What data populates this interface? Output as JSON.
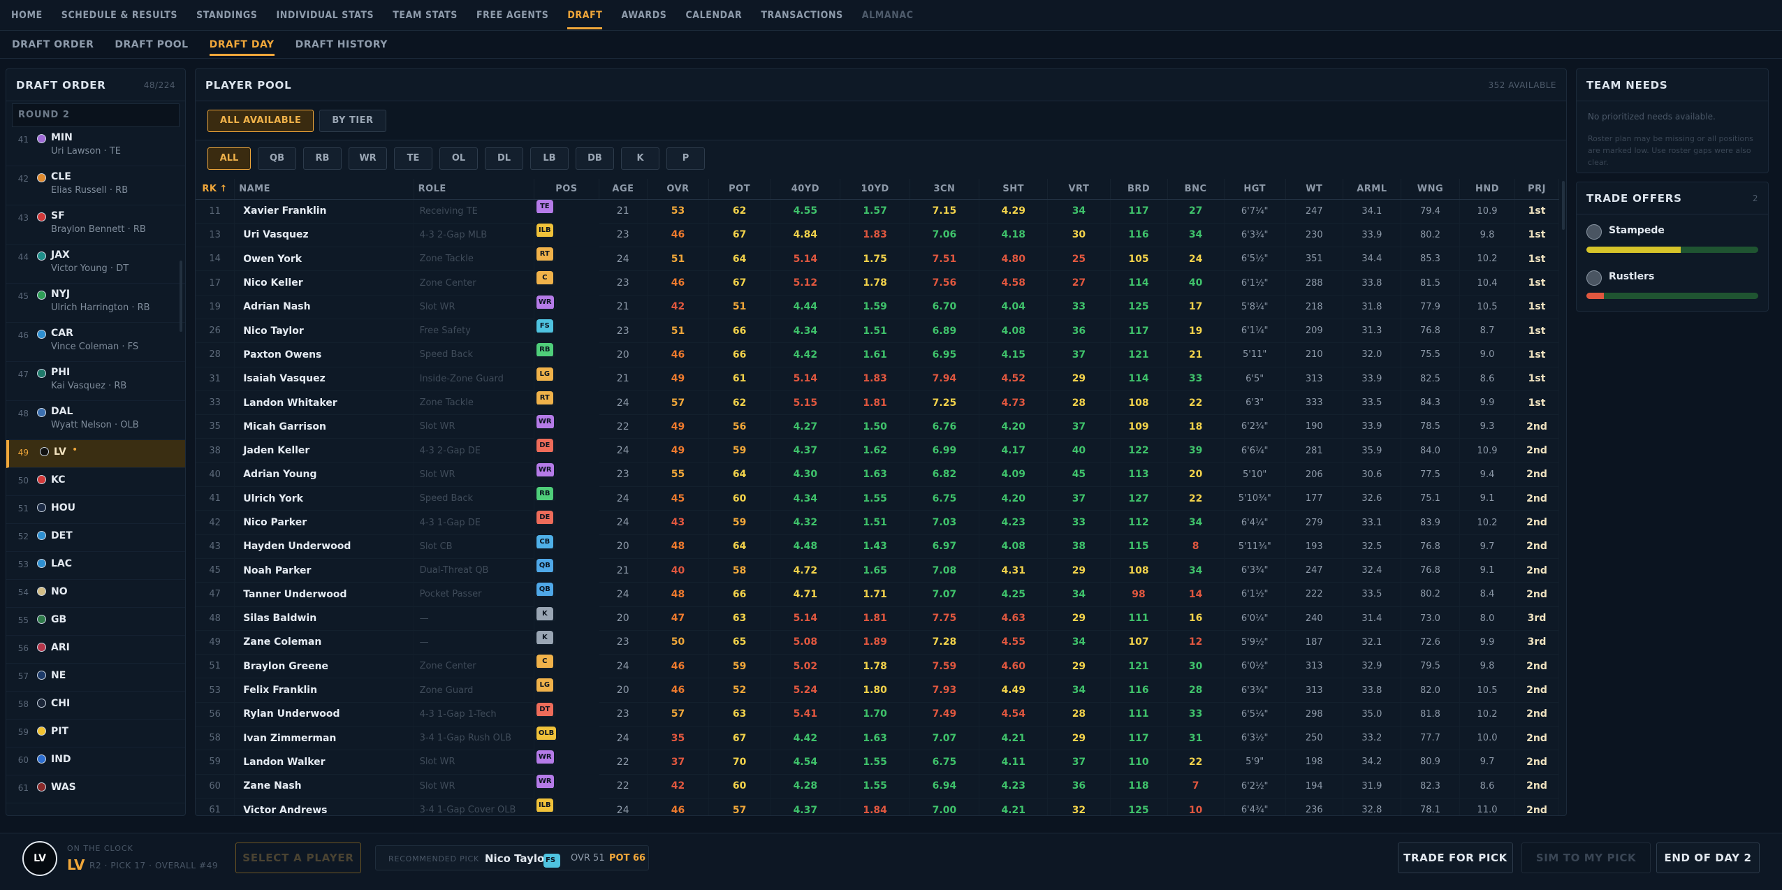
{
  "topnav": [
    "HOME",
    "SCHEDULE & RESULTS",
    "STANDINGS",
    "INDIVIDUAL STATS",
    "TEAM STATS",
    "FREE AGENTS",
    "DRAFT",
    "AWARDS",
    "CALENDAR",
    "TRANSACTIONS",
    "ALMANAC"
  ],
  "subnav": [
    "DRAFT ORDER",
    "DRAFT POOL",
    "DRAFT DAY",
    "DRAFT HISTORY"
  ],
  "draft_order": {
    "title": "DRAFT ORDER",
    "count": "48/224",
    "round": "ROUND 2",
    "picks": [
      {
        "n": "41",
        "team": "MIN",
        "player": "Uri Lawson · TE",
        "color": "#a06bd6"
      },
      {
        "n": "42",
        "team": "CLE",
        "player": "Elias Russell · RB",
        "color": "#e08a2e"
      },
      {
        "n": "43",
        "team": "SF",
        "player": "Braylon Bennett · RB",
        "color": "#d33a3a"
      },
      {
        "n": "44",
        "team": "JAX",
        "player": "Victor Young · DT",
        "color": "#1f8f8a"
      },
      {
        "n": "45",
        "team": "NYJ",
        "player": "Ulrich Harrington · RB",
        "color": "#2f9e57"
      },
      {
        "n": "46",
        "team": "CAR",
        "player": "Vince Coleman · FS",
        "color": "#2e8fd0"
      },
      {
        "n": "47",
        "team": "PHI",
        "player": "Kai Vasquez · RB",
        "color": "#1f7a6a"
      },
      {
        "n": "48",
        "team": "DAL",
        "player": "Wyatt Nelson · OLB",
        "color": "#3b6fb0"
      },
      {
        "n": "49",
        "team": "LV",
        "player": "",
        "color": "#111111",
        "current": true,
        "mark": "•"
      },
      {
        "n": "50",
        "team": "KC",
        "player": "",
        "color": "#d33a3a"
      },
      {
        "n": "51",
        "team": "HOU",
        "player": "",
        "color": "#1b2a44"
      },
      {
        "n": "52",
        "team": "DET",
        "player": "",
        "color": "#2e8fd0"
      },
      {
        "n": "53",
        "team": "LAC",
        "player": "",
        "color": "#2e8fd0"
      },
      {
        "n": "54",
        "team": "NO",
        "player": "",
        "color": "#d2bd86"
      },
      {
        "n": "55",
        "team": "GB",
        "player": "",
        "color": "#2f7a4a"
      },
      {
        "n": "56",
        "team": "ARI",
        "player": "",
        "color": "#b6364a"
      },
      {
        "n": "57",
        "team": "NE",
        "player": "",
        "color": "#1d3a68"
      },
      {
        "n": "58",
        "team": "CHI",
        "player": "",
        "color": "#1b2638"
      },
      {
        "n": "59",
        "team": "PIT",
        "player": "",
        "color": "#f2c230"
      },
      {
        "n": "60",
        "team": "IND",
        "player": "",
        "color": "#2e6fd0"
      },
      {
        "n": "61",
        "team": "WAS",
        "player": "",
        "color": "#8a2a2a"
      }
    ]
  },
  "player_pool": {
    "title": "PLAYER POOL",
    "count": "352 AVAILABLE",
    "tabs": [
      "ALL AVAILABLE",
      "BY TIER"
    ],
    "positions": [
      "ALL",
      "QB",
      "RB",
      "WR",
      "TE",
      "OL",
      "DL",
      "LB",
      "DB",
      "K",
      "P"
    ],
    "columns": [
      "RK",
      "NAME",
      "ROLE",
      "POS",
      "AGE",
      "OVR",
      "POT",
      "40YD",
      "10YD",
      "3CN",
      "SHT",
      "VRT",
      "BRD",
      "BNC",
      "HGT",
      "WT",
      "ARML",
      "WNG",
      "HND",
      "PRJ"
    ],
    "sort_arrow": "↑",
    "rows": [
      [
        "11",
        "Xavier Franklin",
        "Receiving TE",
        "TE",
        "21",
        "53",
        "62",
        "4.55",
        "1.57",
        "7.15",
        "4.29",
        "34",
        "117",
        "27",
        "6'7¼\"",
        "247",
        "34.1",
        "79.4",
        "10.9",
        "1st"
      ],
      [
        "13",
        "Uri Vasquez",
        "4-3 2-Gap MLB",
        "ILB",
        "23",
        "46",
        "67",
        "4.84",
        "1.83",
        "7.06",
        "4.18",
        "30",
        "116",
        "34",
        "6'3¾\"",
        "230",
        "33.9",
        "80.2",
        "9.8",
        "1st"
      ],
      [
        "14",
        "Owen York",
        "Zone Tackle",
        "RT",
        "24",
        "51",
        "64",
        "5.14",
        "1.75",
        "7.51",
        "4.80",
        "25",
        "105",
        "24",
        "6'5½\"",
        "351",
        "34.4",
        "85.3",
        "10.2",
        "1st"
      ],
      [
        "17",
        "Nico Keller",
        "Zone Center",
        "C",
        "23",
        "46",
        "67",
        "5.12",
        "1.78",
        "7.56",
        "4.58",
        "27",
        "114",
        "40",
        "6'1½\"",
        "288",
        "33.8",
        "81.5",
        "10.4",
        "1st"
      ],
      [
        "19",
        "Adrian Nash",
        "Slot WR",
        "WR",
        "21",
        "42",
        "51",
        "4.44",
        "1.59",
        "6.70",
        "4.04",
        "33",
        "125",
        "17",
        "5'8¼\"",
        "218",
        "31.8",
        "77.9",
        "10.5",
        "1st"
      ],
      [
        "26",
        "Nico Taylor",
        "Free Safety",
        "FS",
        "23",
        "51",
        "66",
        "4.34",
        "1.51",
        "6.89",
        "4.08",
        "36",
        "117",
        "19",
        "6'1¼\"",
        "209",
        "31.3",
        "76.8",
        "8.7",
        "1st"
      ],
      [
        "28",
        "Paxton Owens",
        "Speed Back",
        "RB",
        "20",
        "46",
        "66",
        "4.42",
        "1.61",
        "6.95",
        "4.15",
        "37",
        "121",
        "21",
        "5'11\"",
        "210",
        "32.0",
        "75.5",
        "9.0",
        "1st"
      ],
      [
        "31",
        "Isaiah Vasquez",
        "Inside-Zone Guard",
        "LG",
        "21",
        "49",
        "61",
        "5.14",
        "1.83",
        "7.94",
        "4.52",
        "29",
        "114",
        "33",
        "6'5\"",
        "313",
        "33.9",
        "82.5",
        "8.6",
        "1st"
      ],
      [
        "33",
        "Landon Whitaker",
        "Zone Tackle",
        "RT",
        "24",
        "57",
        "62",
        "5.15",
        "1.81",
        "7.25",
        "4.73",
        "28",
        "108",
        "22",
        "6'3\"",
        "333",
        "33.5",
        "84.3",
        "9.9",
        "1st"
      ],
      [
        "35",
        "Micah Garrison",
        "Slot WR",
        "WR",
        "22",
        "49",
        "56",
        "4.27",
        "1.50",
        "6.76",
        "4.20",
        "37",
        "109",
        "18",
        "6'2¾\"",
        "190",
        "33.9",
        "78.5",
        "9.3",
        "2nd"
      ],
      [
        "38",
        "Jaden Keller",
        "4-3 2-Gap DE",
        "DE",
        "24",
        "49",
        "59",
        "4.37",
        "1.62",
        "6.99",
        "4.17",
        "40",
        "122",
        "39",
        "6'6¼\"",
        "281",
        "35.9",
        "84.0",
        "10.9",
        "2nd"
      ],
      [
        "40",
        "Adrian Young",
        "Slot WR",
        "WR",
        "23",
        "55",
        "64",
        "4.30",
        "1.63",
        "6.82",
        "4.09",
        "45",
        "113",
        "20",
        "5'10\"",
        "206",
        "30.6",
        "77.5",
        "9.4",
        "2nd"
      ],
      [
        "41",
        "Ulrich York",
        "Speed Back",
        "RB",
        "24",
        "45",
        "60",
        "4.34",
        "1.55",
        "6.75",
        "4.20",
        "37",
        "127",
        "22",
        "5'10¾\"",
        "177",
        "32.6",
        "75.1",
        "9.1",
        "2nd"
      ],
      [
        "42",
        "Nico Parker",
        "4-3 1-Gap DE",
        "DE",
        "24",
        "43",
        "59",
        "4.32",
        "1.51",
        "7.03",
        "4.23",
        "33",
        "112",
        "34",
        "6'4¼\"",
        "279",
        "33.1",
        "83.9",
        "10.2",
        "2nd"
      ],
      [
        "43",
        "Hayden Underwood",
        "Slot CB",
        "CB",
        "20",
        "48",
        "64",
        "4.48",
        "1.43",
        "6.97",
        "4.08",
        "38",
        "115",
        "8",
        "5'11¾\"",
        "193",
        "32.5",
        "76.8",
        "9.7",
        "2nd"
      ],
      [
        "45",
        "Noah Parker",
        "Dual-Threat QB",
        "QB",
        "21",
        "40",
        "58",
        "4.72",
        "1.65",
        "7.08",
        "4.31",
        "29",
        "108",
        "34",
        "6'3¾\"",
        "247",
        "32.4",
        "76.8",
        "9.1",
        "2nd"
      ],
      [
        "47",
        "Tanner Underwood",
        "Pocket Passer",
        "QB",
        "24",
        "48",
        "66",
        "4.71",
        "1.71",
        "7.07",
        "4.25",
        "34",
        "98",
        "14",
        "6'1½\"",
        "222",
        "33.5",
        "80.2",
        "8.4",
        "2nd"
      ],
      [
        "48",
        "Silas Baldwin",
        "—",
        "K",
        "20",
        "47",
        "63",
        "5.14",
        "1.81",
        "7.75",
        "4.63",
        "29",
        "111",
        "16",
        "6'0¼\"",
        "240",
        "31.4",
        "73.0",
        "8.0",
        "3rd"
      ],
      [
        "49",
        "Zane Coleman",
        "—",
        "K",
        "23",
        "50",
        "65",
        "5.08",
        "1.89",
        "7.28",
        "4.55",
        "34",
        "107",
        "12",
        "5'9½\"",
        "187",
        "32.1",
        "72.6",
        "9.9",
        "3rd"
      ],
      [
        "51",
        "Braylon Greene",
        "Zone Center",
        "C",
        "24",
        "46",
        "59",
        "5.02",
        "1.78",
        "7.59",
        "4.60",
        "29",
        "121",
        "30",
        "6'0½\"",
        "313",
        "32.9",
        "79.5",
        "9.8",
        "2nd"
      ],
      [
        "53",
        "Felix Franklin",
        "Zone Guard",
        "LG",
        "20",
        "46",
        "52",
        "5.24",
        "1.80",
        "7.93",
        "4.49",
        "34",
        "116",
        "28",
        "6'3¾\"",
        "313",
        "33.8",
        "82.0",
        "10.5",
        "2nd"
      ],
      [
        "56",
        "Rylan Underwood",
        "4-3 1-Gap 1-Tech",
        "DT",
        "23",
        "57",
        "63",
        "5.41",
        "1.70",
        "7.49",
        "4.54",
        "28",
        "111",
        "33",
        "6'5¼\"",
        "298",
        "35.0",
        "81.8",
        "10.2",
        "2nd"
      ],
      [
        "58",
        "Ivan Zimmerman",
        "3-4 1-Gap Rush OLB",
        "OLB",
        "24",
        "35",
        "67",
        "4.42",
        "1.63",
        "7.07",
        "4.21",
        "29",
        "117",
        "31",
        "6'3½\"",
        "250",
        "33.2",
        "77.7",
        "10.0",
        "2nd"
      ],
      [
        "59",
        "Landon Walker",
        "Slot WR",
        "WR",
        "22",
        "37",
        "70",
        "4.54",
        "1.55",
        "6.75",
        "4.11",
        "37",
        "110",
        "22",
        "5'9\"",
        "198",
        "34.2",
        "80.9",
        "9.7",
        "2nd"
      ],
      [
        "60",
        "Zane Nash",
        "Slot WR",
        "WR",
        "22",
        "42",
        "60",
        "4.28",
        "1.55",
        "6.94",
        "4.23",
        "36",
        "118",
        "7",
        "6'2½\"",
        "194",
        "31.9",
        "82.3",
        "8.6",
        "2nd"
      ],
      [
        "61",
        "Victor Andrews",
        "3-4 1-Gap Cover OLB",
        "ILB",
        "24",
        "46",
        "57",
        "4.37",
        "1.84",
        "7.00",
        "4.21",
        "32",
        "125",
        "10",
        "6'4¾\"",
        "236",
        "32.8",
        "78.1",
        "11.0",
        "2nd"
      ]
    ]
  },
  "team_needs": {
    "title": "TEAM NEEDS",
    "line1": "No prioritized needs available.",
    "line2": "Roster plan may be missing or all positions are marked low. Use roster gaps were also clear."
  },
  "trade_offers": {
    "title": "TRADE OFFERS",
    "count": "2",
    "offers": [
      {
        "name": "Stampede",
        "level": 0.55,
        "fill": "#d6c42a"
      },
      {
        "name": "Rustlers",
        "level": 0.1,
        "fill": "#e0573f"
      }
    ]
  },
  "bottom": {
    "badge": "LV",
    "on_clock": "ON THE CLOCK",
    "team": "LV",
    "pick": "R2 · PICK 17 · OVERALL #49",
    "select": "SELECT A PLAYER",
    "rec_label": "RECOMMENDED PICK",
    "rec_name": "Nico Taylor",
    "rec_pos": "FS",
    "rec_ovr": "OVR 51",
    "rec_pot": "POT 66",
    "trade": "TRADE FOR PICK",
    "sim": "SIM TO MY PICK",
    "end": "END OF DAY 2"
  },
  "pos_colors": {
    "TE": "#b57be8",
    "ILB": "#f0c23a",
    "OLB": "#f0c23a",
    "RT": "#f0b24a",
    "LG": "#f0b24a",
    "C": "#f0b24a",
    "WR": "#b57be8",
    "FS": "#4fc3e0",
    "CB": "#4fb0e8",
    "RB": "#4fce7a",
    "DE": "#ee6c5a",
    "DT": "#ee6c5a",
    "QB": "#4fa8e8",
    "K": "#9aa6b4"
  }
}
